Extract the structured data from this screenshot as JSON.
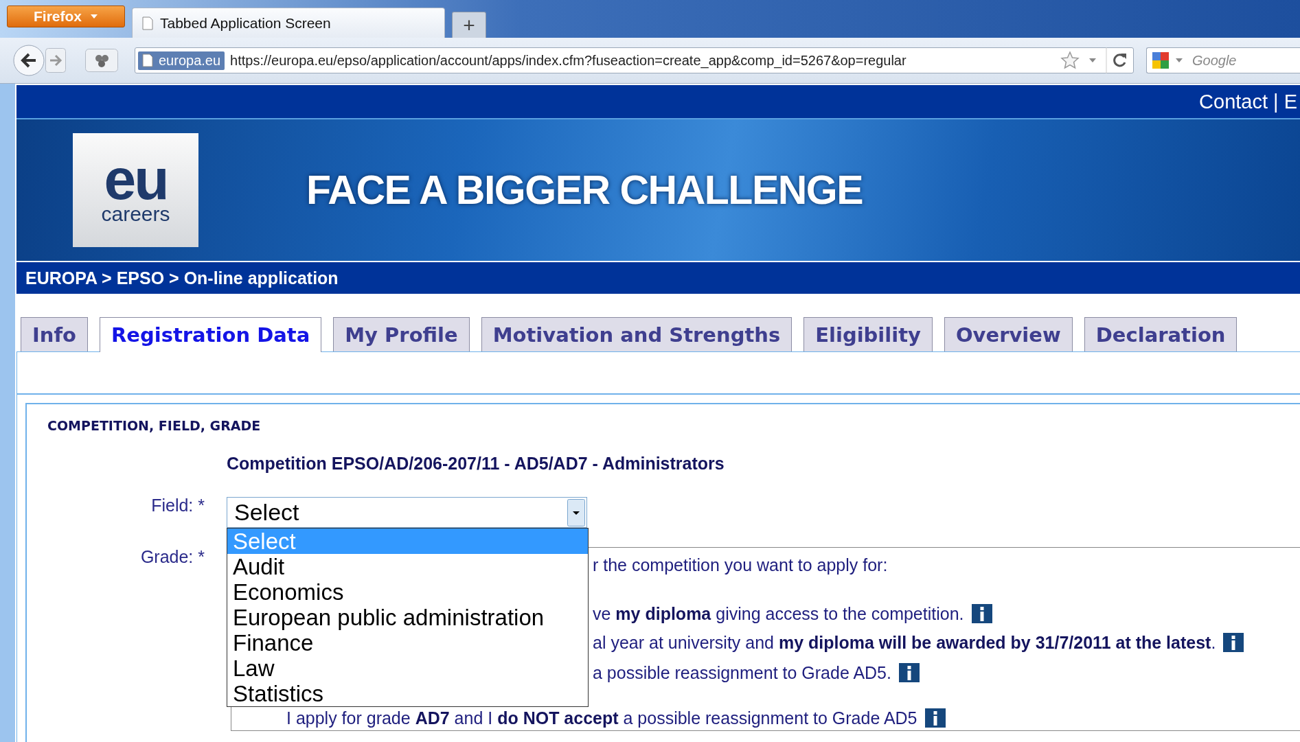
{
  "browser": {
    "menu_button": "Firefox",
    "tab_title": "Tabbed Application Screen",
    "new_tab": "+",
    "site_badge": "europa.eu",
    "url": "https://europa.eu/epso/application/account/apps/index.cfm?fuseaction=create_app&comp_id=5267&op=regular",
    "search_placeholder": "Google"
  },
  "header": {
    "links": "Contact | E"
  },
  "banner": {
    "logo_main": "eu",
    "logo_sub": "careers",
    "headline": "FACE A BIGGER CHALLENGE"
  },
  "breadcrumb": "EUROPA > EPSO > On-line application",
  "tabs": [
    {
      "label": "Info",
      "selected": false
    },
    {
      "label": "Registration Data",
      "selected": true
    },
    {
      "label": "My Profile",
      "selected": false
    },
    {
      "label": "Motivation and Strengths",
      "selected": false
    },
    {
      "label": "Eligibility",
      "selected": false
    },
    {
      "label": "Overview",
      "selected": false
    },
    {
      "label": "Declaration",
      "selected": false
    }
  ],
  "section_title": "COMPETITION, FIELD, GRADE",
  "competition": "Competition EPSO/AD/206-207/11 - AD5/AD7 - Administrators",
  "field": {
    "label": "Field: *",
    "value": "Select",
    "options": [
      {
        "label": "Select",
        "selected": true
      },
      {
        "label": "Audit",
        "selected": false
      },
      {
        "label": "Economics",
        "selected": false
      },
      {
        "label": "European public administration",
        "selected": false
      },
      {
        "label": "Finance",
        "selected": false
      },
      {
        "label": "Law",
        "selected": false
      },
      {
        "label": "Statistics",
        "selected": false
      }
    ]
  },
  "grade": {
    "label": "Grade: *",
    "lines": [
      {
        "text": "r the competition you want to apply for:",
        "info": false
      },
      {
        "text": "ve **my diploma** giving access to the competition.",
        "info": true
      },
      {
        "text": "al year at university and **my diploma will be awarded by 31/7/2011 at the latest**.",
        "info": true
      },
      {
        "text": "a possible reassignment to Grade AD5.",
        "info": true
      },
      {
        "text": "I apply for grade **AD7** and I **do NOT accept** a possible reassignment to Grade AD5",
        "info": true
      }
    ]
  }
}
